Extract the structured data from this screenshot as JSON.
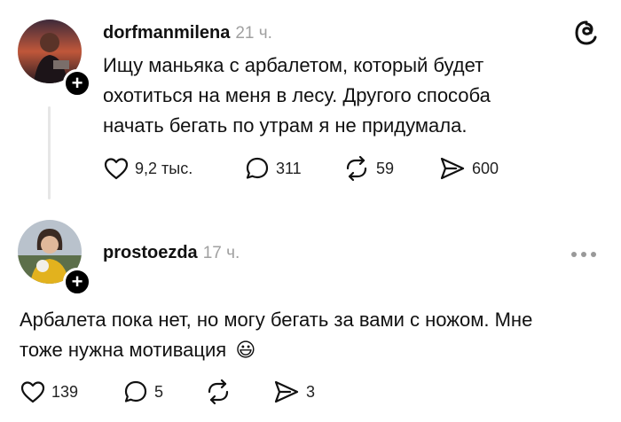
{
  "post1": {
    "username": "dorfmanmilena",
    "time": "21 ч.",
    "text_line1": "Ищу маньяка с арбалетом, который будет",
    "text_line2": "охотиться на меня в лесу. Другого способа",
    "text_line3": "начать бегать по утрам я не придумала.",
    "likes": "9,2 тыс.",
    "comments": "311",
    "reposts": "59",
    "shares": "600"
  },
  "post2": {
    "username": "prostoezda",
    "time": "17 ч.",
    "text_line1": "Арбалета пока нет, но могу бегать за вами с ножом. Мне",
    "text_line2": "тоже нужна мотивация",
    "emoji": "😃",
    "likes": "139",
    "comments": "5",
    "reposts": "",
    "shares": "3"
  },
  "icons": {
    "app_logo": "threads-logo-icon",
    "more": "more-options-icon",
    "like": "heart-icon",
    "comment": "comment-icon",
    "repost": "repost-icon",
    "share": "share-icon"
  },
  "colors": {
    "text": "#111111",
    "muted": "#a0a0a0",
    "thread_line": "#e6e6e6"
  }
}
